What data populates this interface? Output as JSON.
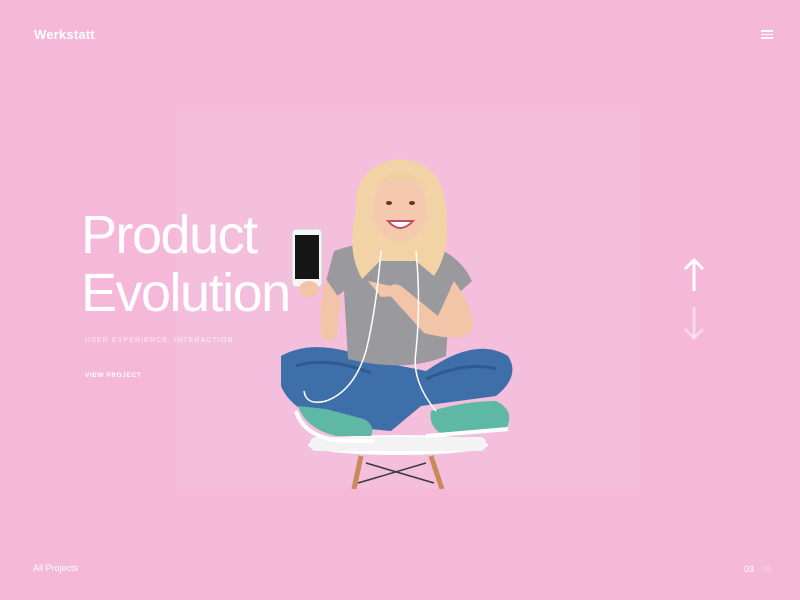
{
  "brand": {
    "name": "Werkstatt"
  },
  "header": {
    "menu_icon": "hamburger-menu-icon"
  },
  "hero": {
    "title_line1": "Product",
    "title_line2": "Evolution",
    "tags": "USER EXPERIENCE, INTERACTION",
    "cta_label": "VIEW PROJECT",
    "image_description_icon": "woman-with-phone-photo"
  },
  "navigation": {
    "prev_icon": "arrow-up-icon",
    "next_icon": "arrow-down-icon"
  },
  "footer": {
    "all_projects_label": "All Projects",
    "current_index": "03",
    "total_index": "06"
  },
  "colors": {
    "background": "#f6b8d9",
    "card": "#f4bfdd",
    "text": "#ffffff"
  }
}
